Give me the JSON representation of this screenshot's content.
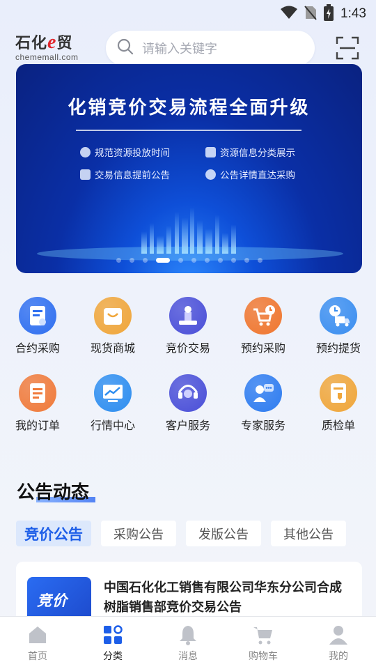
{
  "status_bar": {
    "time": "1:43"
  },
  "header": {
    "logo_text_1": "石化",
    "logo_text_e": "e",
    "logo_text_2": "贸",
    "logo_domain": "chememall.com",
    "search_placeholder": "请输入关键字"
  },
  "banner": {
    "title": "化销竞价交易流程全面升级",
    "features": [
      "规范资源投放时间",
      "资源信息分类展示",
      "交易信息提前公告",
      "公告详情直达采购"
    ],
    "slide_count": 11,
    "active_slide": 3
  },
  "grid": [
    {
      "label": "合约采购",
      "icon": "contract-icon",
      "color": "#2f6ff0"
    },
    {
      "label": "现货商城",
      "icon": "shopping-bag-icon",
      "color": "#f0a63a"
    },
    {
      "label": "竞价交易",
      "icon": "auction-icon",
      "color": "#4a4fd8"
    },
    {
      "label": "预约采购",
      "icon": "cart-clock-icon",
      "color": "#f0762e"
    },
    {
      "label": "预约提货",
      "icon": "truck-clock-icon",
      "color": "#3a8ef0"
    },
    {
      "label": "我的订单",
      "icon": "order-list-icon",
      "color": "#f07a3a"
    },
    {
      "label": "行情中心",
      "icon": "market-chart-icon",
      "color": "#2e8ef0"
    },
    {
      "label": "客户服务",
      "icon": "headset-icon",
      "color": "#4a4fd8"
    },
    {
      "label": "专家服务",
      "icon": "expert-chat-icon",
      "color": "#2e7cf0"
    },
    {
      "label": "质检单",
      "icon": "quality-doc-icon",
      "color": "#f0a63a"
    }
  ],
  "announcements": {
    "title": "公告动态",
    "tabs": [
      "竞价公告",
      "采购公告",
      "发版公告",
      "其他公告"
    ],
    "active_tab": 0,
    "cards": [
      {
        "thumb_text": "竞价",
        "title": "中国石化化工销售有限公司华东分公司合成树脂销售部竞价交易公告"
      }
    ]
  },
  "bottom_nav": [
    {
      "label": "首页",
      "icon": "home-icon"
    },
    {
      "label": "分类",
      "icon": "category-icon"
    },
    {
      "label": "消息",
      "icon": "bell-icon"
    },
    {
      "label": "购物车",
      "icon": "cart-icon"
    },
    {
      "label": "我的",
      "icon": "user-icon"
    }
  ],
  "active_nav": 1,
  "colors": {
    "primary": "#1d5ee8",
    "banner_bg": "#0a2fa6",
    "logo_e": "#e2262c"
  }
}
